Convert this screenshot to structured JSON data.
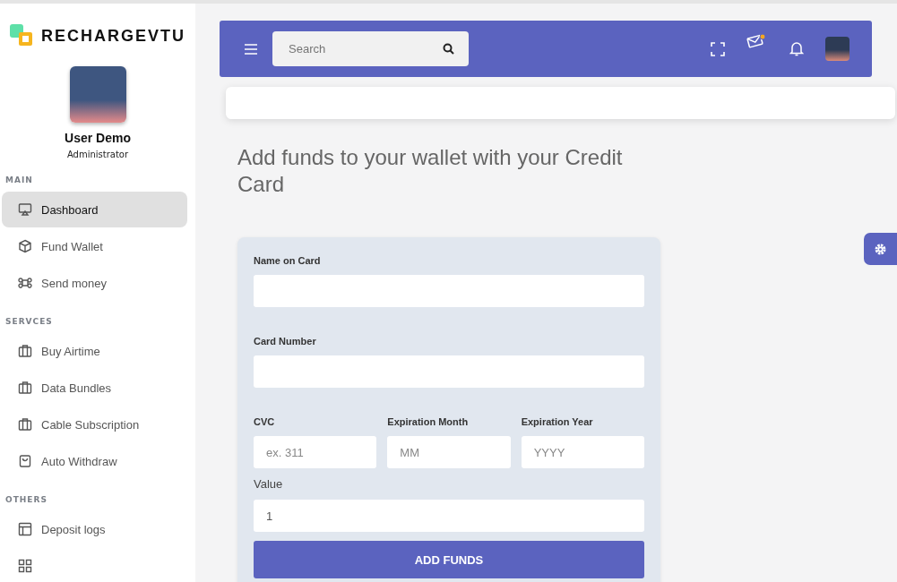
{
  "brand": {
    "name": "RECHARGEVTU"
  },
  "user": {
    "name": "User Demo",
    "role": "Administrator"
  },
  "sidebar": {
    "sections": [
      {
        "title": "MAIN",
        "items": [
          {
            "label": "Dashboard",
            "kind": "screen",
            "selected": true
          },
          {
            "label": "Fund Wallet",
            "kind": "box",
            "selected": false
          },
          {
            "label": "Send money",
            "kind": "command",
            "selected": false
          }
        ]
      },
      {
        "title": "SERVCES",
        "items": [
          {
            "label": "Buy Airtime",
            "kind": "bag",
            "selected": false
          },
          {
            "label": "Data Bundles",
            "kind": "bag",
            "selected": false
          },
          {
            "label": "Cable Subscription",
            "kind": "bag",
            "selected": false
          },
          {
            "label": "Auto Withdraw",
            "kind": "cart",
            "selected": false
          }
        ]
      },
      {
        "title": "OTHERS",
        "items": [
          {
            "label": "Deposit logs",
            "kind": "layout",
            "selected": false
          },
          {
            "kind": "grid",
            "selected": false
          }
        ]
      }
    ]
  },
  "header": {
    "search": {
      "placeholder": "Search"
    },
    "mail_unread": true
  },
  "page": {
    "title": "Add funds to your wallet with your Credit Card"
  },
  "form": {
    "fields": [
      {
        "label": "Name on Card"
      },
      {
        "label": "Card Number"
      }
    ],
    "row": [
      {
        "label": "CVC",
        "placeholder": "ex. 311"
      },
      {
        "label": "Expiration Month",
        "placeholder": "MM"
      },
      {
        "label": "Expiration Year",
        "placeholder": "YYYY"
      }
    ],
    "value_field": {
      "label": "Value",
      "value": "1"
    },
    "submit": "ADD FUNDS"
  }
}
